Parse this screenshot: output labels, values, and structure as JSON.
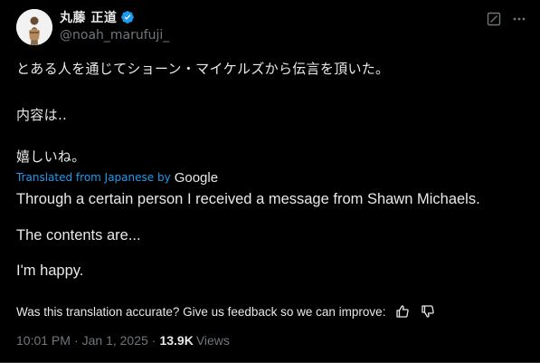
{
  "author": {
    "display_name": "丸藤 正道",
    "handle": "@noah_marufuji_",
    "verified_icon": "verified-badge-icon"
  },
  "actions": {
    "grok_icon": "grok-icon",
    "more_icon": "more-icon"
  },
  "original_text": {
    "line1": "とある人を通じてショーン・マイケルズから伝言を頂いた。",
    "line2": "内容は‥",
    "line3": "嬉しいね。"
  },
  "translation": {
    "label": "Translated from Japanese by",
    "provider": "Google",
    "line1": "Through a certain person I received a message from Shawn Michaels.",
    "line2": "The contents are...",
    "line3": "I'm happy."
  },
  "feedback": {
    "prompt": "Was this translation accurate? Give us feedback so we can improve:",
    "like_icon": "thumbs-up-icon",
    "dislike_icon": "thumbs-down-icon"
  },
  "meta": {
    "time": "10:01 PM",
    "separator": "·",
    "date": "Jan 1, 2025",
    "view_count": "13.9K",
    "views_label": "Views"
  },
  "colors": {
    "background": "#000000",
    "text": "#e7e9ea",
    "muted": "#71767b",
    "accent": "#1d9bf0"
  }
}
